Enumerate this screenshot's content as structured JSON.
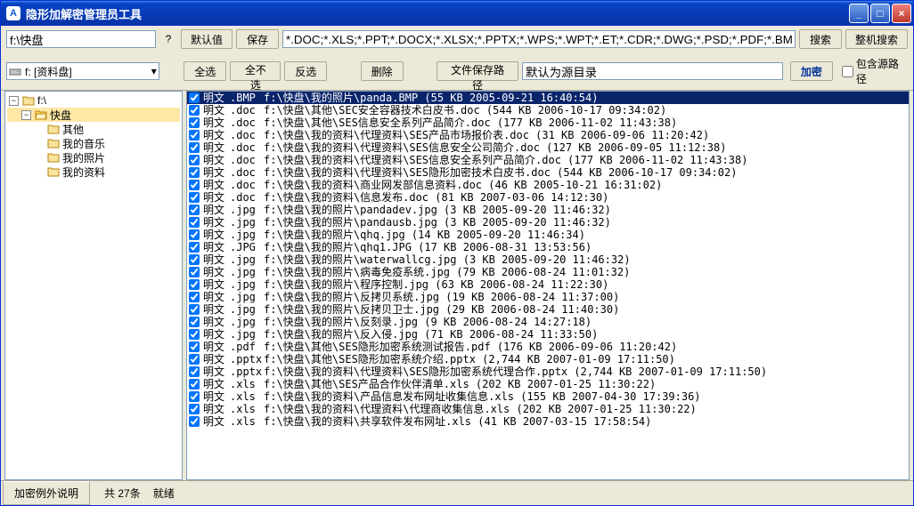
{
  "window": {
    "title": "隐形加解密管理员工具"
  },
  "toolbar": {
    "path_value": "f:\\快盘",
    "q": "?",
    "default_btn": "默认值",
    "save_btn": "保存",
    "ext_value": "*.DOC;*.XLS;*.PPT;*.DOCX;*.XLSX;*.PPTX;*.WPS;*.WPT;*.ET;*.CDR;*.DWG;*.PSD;*.PDF;*.BMP;…",
    "search_btn": "搜索",
    "full_search_btn": "整机搜索",
    "drive_text": "f: [资料盘]",
    "select_all": "全选",
    "select_none": "全不选",
    "invert_sel": "反选",
    "delete_btn": "删除",
    "save_path_btn": "文件保存路径",
    "default_target_value": "默认为源目录",
    "encrypt_btn": "加密",
    "include_src_label": "包含源路径"
  },
  "tree": {
    "root": "f:\\",
    "kuaipan": "快盘",
    "children": [
      "其他",
      "我的音乐",
      "我的照片",
      "我的资料"
    ]
  },
  "files": [
    {
      "status": "明文",
      "ext": ".BMP",
      "path": "f:\\快盘\\我的照片\\panda.BMP (55 KB 2005-09-21 16:40:54)",
      "sel": true
    },
    {
      "status": "明文",
      "ext": ".doc",
      "path": "f:\\快盘\\其他\\SEC安全容器技术白皮书.doc (544 KB 2006-10-17 09:34:02)"
    },
    {
      "status": "明文",
      "ext": ".doc",
      "path": "f:\\快盘\\其他\\SES信息安全系列产品简介.doc (177 KB 2006-11-02 11:43:38)"
    },
    {
      "status": "明文",
      "ext": ".doc",
      "path": "f:\\快盘\\我的资料\\代理资料\\SES产品市场报价表.doc (31 KB 2006-09-06 11:20:42)"
    },
    {
      "status": "明文",
      "ext": ".doc",
      "path": "f:\\快盘\\我的资料\\代理资料\\SES信息安全公司简介.doc (127 KB 2006-09-05 11:12:38)"
    },
    {
      "status": "明文",
      "ext": ".doc",
      "path": "f:\\快盘\\我的资料\\代理资料\\SES信息安全系列产品简介.doc (177 KB 2006-11-02 11:43:38)"
    },
    {
      "status": "明文",
      "ext": ".doc",
      "path": "f:\\快盘\\我的资料\\代理资料\\SES隐形加密技术白皮书.doc (544 KB 2006-10-17 09:34:02)"
    },
    {
      "status": "明文",
      "ext": ".doc",
      "path": "f:\\快盘\\我的资料\\商业网发部信息资料.doc (46 KB 2005-10-21 16:31:02)"
    },
    {
      "status": "明文",
      "ext": ".doc",
      "path": "f:\\快盘\\我的资料\\信息发布.doc (81 KB 2007-03-06 14:12:30)"
    },
    {
      "status": "明文",
      "ext": ".jpg",
      "path": "f:\\快盘\\我的照片\\pandadev.jpg (3 KB 2005-09-20 11:46:32)"
    },
    {
      "status": "明文",
      "ext": ".jpg",
      "path": "f:\\快盘\\我的照片\\pandausb.jpg (3 KB 2005-09-20 11:46:32)"
    },
    {
      "status": "明文",
      "ext": ".jpg",
      "path": "f:\\快盘\\我的照片\\qhq.jpg (14 KB 2005-09-20 11:46:34)"
    },
    {
      "status": "明文",
      "ext": ".JPG",
      "path": "f:\\快盘\\我的照片\\qhq1.JPG (17 KB 2006-08-31 13:53:56)"
    },
    {
      "status": "明文",
      "ext": ".jpg",
      "path": "f:\\快盘\\我的照片\\waterwallcg.jpg (3 KB 2005-09-20 11:46:32)"
    },
    {
      "status": "明文",
      "ext": ".jpg",
      "path": "f:\\快盘\\我的照片\\病毒免疫系统.jpg (79 KB 2006-08-24 11:01:32)"
    },
    {
      "status": "明文",
      "ext": ".jpg",
      "path": "f:\\快盘\\我的照片\\程序控制.jpg (63 KB 2006-08-24 11:22:30)"
    },
    {
      "status": "明文",
      "ext": ".jpg",
      "path": "f:\\快盘\\我的照片\\反拷贝系统.jpg (19 KB 2006-08-24 11:37:00)"
    },
    {
      "status": "明文",
      "ext": ".jpg",
      "path": "f:\\快盘\\我的照片\\反拷贝卫士.jpg (29 KB 2006-08-24 11:40:30)"
    },
    {
      "status": "明文",
      "ext": ".jpg",
      "path": "f:\\快盘\\我的照片\\反刻录.jpg (9 KB 2006-08-24 14:27:18)"
    },
    {
      "status": "明文",
      "ext": ".jpg",
      "path": "f:\\快盘\\我的照片\\反入侵.jpg (71 KB 2006-08-24 11:33:50)"
    },
    {
      "status": "明文",
      "ext": ".pdf",
      "path": "f:\\快盘\\其他\\SES隐形加密系统测试报告.pdf (176 KB 2006-09-06 11:20:42)"
    },
    {
      "status": "明文",
      "ext": ".pptx",
      "path": "f:\\快盘\\其他\\SES隐形加密系统介绍.pptx (2,744 KB 2007-01-09 17:11:50)"
    },
    {
      "status": "明文",
      "ext": ".pptx",
      "path": "f:\\快盘\\我的资料\\代理资料\\SES隐形加密系统代理合作.pptx (2,744 KB 2007-01-09 17:11:50)"
    },
    {
      "status": "明文",
      "ext": ".xls",
      "path": "f:\\快盘\\其他\\SES产品合作伙伴清单.xls (202 KB 2007-01-25 11:30:22)"
    },
    {
      "status": "明文",
      "ext": ".xls",
      "path": "f:\\快盘\\我的资料\\产品信息发布网址收集信息.xls (155 KB 2007-04-30 17:39:36)"
    },
    {
      "status": "明文",
      "ext": ".xls",
      "path": "f:\\快盘\\我的资料\\代理资料\\代理商收集信息.xls (202 KB 2007-01-25 11:30:22)"
    },
    {
      "status": "明文",
      "ext": ".xls",
      "path": "f:\\快盘\\我的资料\\共享软件发布网址.xls (41 KB 2007-03-15 17:58:54)"
    }
  ],
  "status": {
    "help_btn": "加密例外说明",
    "count_text": "共 27条",
    "ready_text": "就绪"
  }
}
